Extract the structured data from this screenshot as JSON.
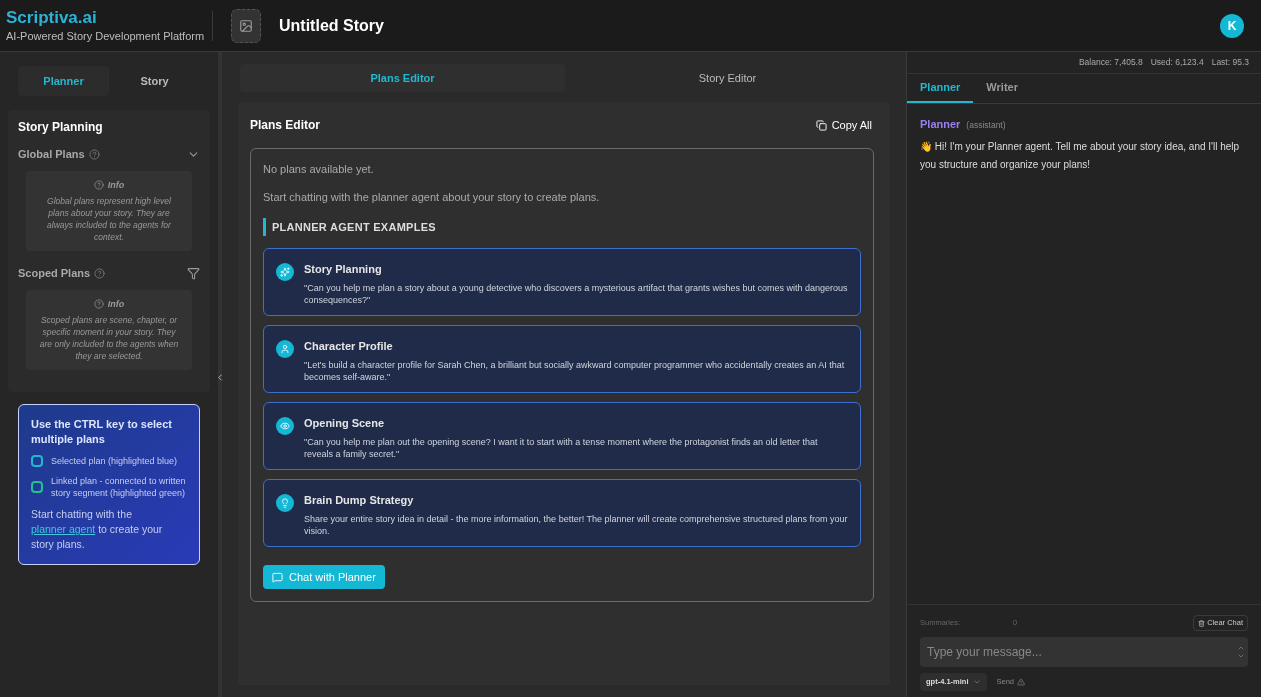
{
  "header": {
    "brand": "Scriptiva.ai",
    "tagline": "AI-Powered Story Development Platform",
    "title": "Untitled Story",
    "avatar": "K"
  },
  "left": {
    "tabs": [
      {
        "label": "Planner",
        "selected": true
      },
      {
        "label": "Story",
        "selected": false
      }
    ],
    "heading": "Story Planning",
    "sections": [
      {
        "title": "Global Plans",
        "kind": "collapse",
        "info_title": "Info",
        "info": "Global plans represent high level plans about your story. They are always included to the agents for context."
      },
      {
        "title": "Scoped Plans",
        "kind": "filter",
        "info_title": "Info",
        "info": "Scoped plans are scene, chapter, or specific moment in your story. They are only included to the agents when they are selected."
      }
    ],
    "hint": {
      "title": "Use the CTRL key to select multiple plans",
      "legend": [
        {
          "label": "Selected plan (highlighted blue)",
          "color": "#22b8cf"
        },
        {
          "label": "Linked plan - connected to written story segment (highlighted green)",
          "color": "#22c08a"
        }
      ],
      "before": "Start chatting with the",
      "link": "planner agent",
      "after": "to create your story plans."
    }
  },
  "center": {
    "tabs": [
      {
        "label": "Plans Editor",
        "selected": true
      },
      {
        "label": "Story Editor",
        "selected": false
      }
    ],
    "title": "Plans Editor",
    "copy": "Copy All",
    "empty": "No plans available yet.",
    "empty_hint": "Start chatting with the planner agent about your story to create plans.",
    "examples_title": "PLANNER AGENT EXAMPLES",
    "examples": [
      {
        "title": "Story Planning",
        "text": "\"Can you help me plan a story about a young detective who discovers a mysterious artifact that grants wishes but comes with dangerous consequences?\""
      },
      {
        "title": "Character Profile",
        "text": "\"Let's build a character profile for Sarah Chen, a brilliant but socially awkward computer programmer who accidentally creates an AI that becomes self-aware.\""
      },
      {
        "title": "Opening Scene",
        "text": "\"Can you help me plan out the opening scene? I want it to start with a tense moment where the protagonist finds an old letter that reveals a family secret.\""
      },
      {
        "title": "Brain Dump Strategy",
        "text": "Share your entire story idea in detail - the more information, the better! The planner will create comprehensive structured plans from your vision."
      }
    ],
    "chat_button": "Chat with Planner"
  },
  "right": {
    "stats": [
      "Balance: 7,405.8",
      "Used: 6,123.4",
      "Last: 95.3"
    ],
    "tabs": [
      {
        "label": "Planner",
        "selected": true
      },
      {
        "label": "Writer",
        "selected": false
      }
    ],
    "messages": [
      {
        "author": "Planner",
        "role": "(assistant)",
        "text": "👋 Hi! I'm your Planner agent. Tell me about your story idea, and I'll help you structure and organize your plans!"
      }
    ],
    "summaries_label": "Summaries:",
    "summaries_count": "0",
    "clear": "Clear Chat",
    "placeholder": "Type your message...",
    "model": "gpt-4.1-mini",
    "send": "Send"
  }
}
